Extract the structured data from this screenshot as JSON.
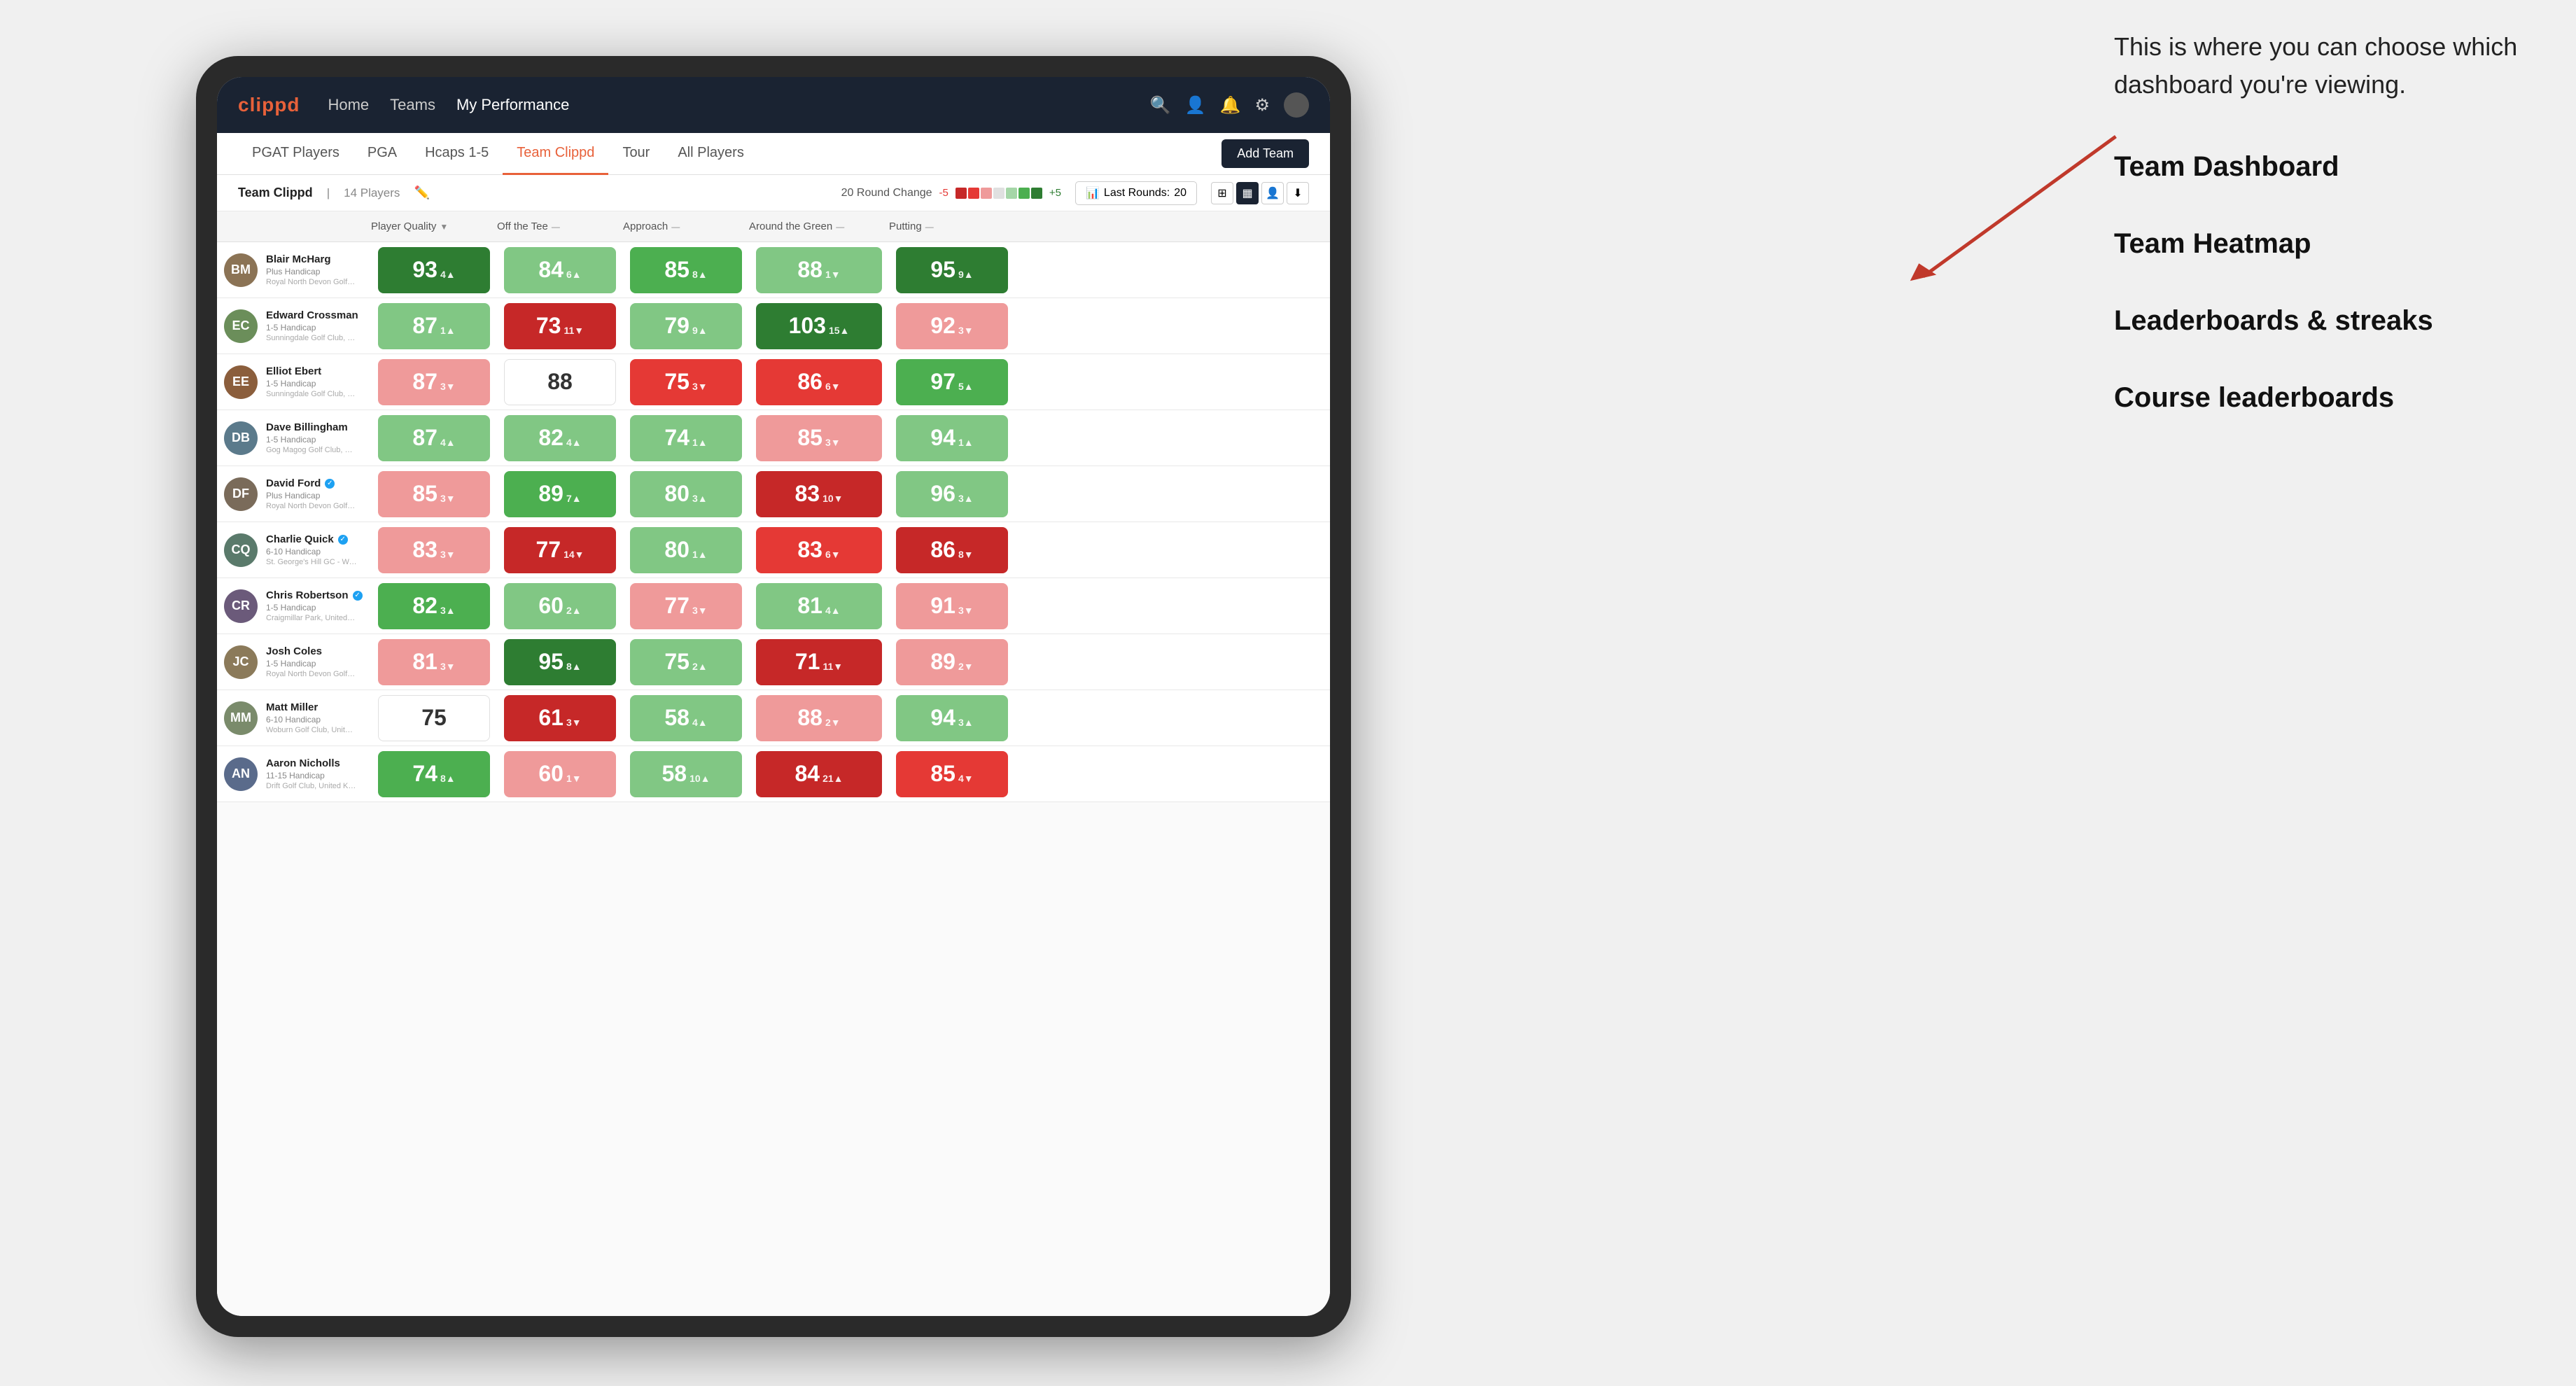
{
  "annotation": {
    "intro_text": "This is where you can choose which dashboard you're viewing.",
    "items": [
      "Team Dashboard",
      "Team Heatmap",
      "Leaderboards & streaks",
      "Course leaderboards"
    ]
  },
  "nav": {
    "logo": "clippd",
    "items": [
      "Home",
      "Teams",
      "My Performance"
    ],
    "active": "My Performance"
  },
  "sub_tabs": {
    "items": [
      "PGAT Players",
      "PGA",
      "Hcaps 1-5",
      "Team Clippd",
      "Tour",
      "All Players"
    ],
    "active": "Team Clippd",
    "add_button": "Add Team"
  },
  "team_bar": {
    "name": "Team Clippd",
    "count": "14 Players",
    "round_change_label": "20 Round Change",
    "range_low": "-5",
    "range_high": "+5",
    "last_rounds_label": "Last Rounds:",
    "last_rounds_value": "20"
  },
  "table": {
    "headers": {
      "player": "Player Quality",
      "tee": "Off the Tee",
      "approach": "Approach",
      "green": "Around the Green",
      "putting": "Putting"
    },
    "players": [
      {
        "name": "Blair McHarg",
        "hcap": "Plus Handicap",
        "club": "Royal North Devon Golf Club, United Kingdom",
        "avatar_color": "#8B7355",
        "initials": "BM",
        "quality": {
          "value": "93",
          "change": "4",
          "dir": "up",
          "color": "green-strong"
        },
        "tee": {
          "value": "84",
          "change": "6",
          "dir": "up",
          "color": "green-light"
        },
        "approach": {
          "value": "85",
          "change": "8",
          "dir": "up",
          "color": "green-mid"
        },
        "green": {
          "value": "88",
          "change": "1",
          "dir": "down",
          "color": "green-light"
        },
        "putting": {
          "value": "95",
          "change": "9",
          "dir": "up",
          "color": "green-strong"
        }
      },
      {
        "name": "Edward Crossman",
        "hcap": "1-5 Handicap",
        "club": "Sunningdale Golf Club, United Kingdom",
        "avatar_color": "#6B8E5A",
        "initials": "EC",
        "quality": {
          "value": "87",
          "change": "1",
          "dir": "up",
          "color": "green-light"
        },
        "tee": {
          "value": "73",
          "change": "11",
          "dir": "down",
          "color": "red-strong"
        },
        "approach": {
          "value": "79",
          "change": "9",
          "dir": "up",
          "color": "green-light"
        },
        "green": {
          "value": "103",
          "change": "15",
          "dir": "up",
          "color": "green-strong"
        },
        "putting": {
          "value": "92",
          "change": "3",
          "dir": "down",
          "color": "red-light"
        }
      },
      {
        "name": "Elliot Ebert",
        "hcap": "1-5 Handicap",
        "club": "Sunningdale Golf Club, United Kingdom",
        "avatar_color": "#8B5E3C",
        "initials": "EE",
        "quality": {
          "value": "87",
          "change": "3",
          "dir": "down",
          "color": "red-light"
        },
        "tee": {
          "value": "88",
          "change": "",
          "dir": "none",
          "color": "white"
        },
        "approach": {
          "value": "75",
          "change": "3",
          "dir": "down",
          "color": "red-mid"
        },
        "green": {
          "value": "86",
          "change": "6",
          "dir": "down",
          "color": "red-mid"
        },
        "putting": {
          "value": "97",
          "change": "5",
          "dir": "up",
          "color": "green-mid"
        }
      },
      {
        "name": "Dave Billingham",
        "hcap": "1-5 Handicap",
        "club": "Gog Magog Golf Club, United Kingdom",
        "avatar_color": "#5B7A8B",
        "initials": "DB",
        "quality": {
          "value": "87",
          "change": "4",
          "dir": "up",
          "color": "green-light"
        },
        "tee": {
          "value": "82",
          "change": "4",
          "dir": "up",
          "color": "green-light"
        },
        "approach": {
          "value": "74",
          "change": "1",
          "dir": "up",
          "color": "green-light"
        },
        "green": {
          "value": "85",
          "change": "3",
          "dir": "down",
          "color": "red-light"
        },
        "putting": {
          "value": "94",
          "change": "1",
          "dir": "up",
          "color": "green-light"
        }
      },
      {
        "name": "David Ford",
        "hcap": "Plus Handicap",
        "club": "Royal North Devon Golf Club, United Kingdom",
        "avatar_color": "#7A6B5A",
        "initials": "DF",
        "verified": true,
        "quality": {
          "value": "85",
          "change": "3",
          "dir": "down",
          "color": "red-light"
        },
        "tee": {
          "value": "89",
          "change": "7",
          "dir": "up",
          "color": "green-mid"
        },
        "approach": {
          "value": "80",
          "change": "3",
          "dir": "up",
          "color": "green-light"
        },
        "green": {
          "value": "83",
          "change": "10",
          "dir": "down",
          "color": "red-strong"
        },
        "putting": {
          "value": "96",
          "change": "3",
          "dir": "up",
          "color": "green-light"
        }
      },
      {
        "name": "Charlie Quick",
        "hcap": "6-10 Handicap",
        "club": "St. George's Hill GC - Weybridge - Surrey, Uni...",
        "avatar_color": "#5A7A6B",
        "initials": "CQ",
        "verified": true,
        "quality": {
          "value": "83",
          "change": "3",
          "dir": "down",
          "color": "red-light"
        },
        "tee": {
          "value": "77",
          "change": "14",
          "dir": "down",
          "color": "red-strong"
        },
        "approach": {
          "value": "80",
          "change": "1",
          "dir": "up",
          "color": "green-light"
        },
        "green": {
          "value": "83",
          "change": "6",
          "dir": "down",
          "color": "red-mid"
        },
        "putting": {
          "value": "86",
          "change": "8",
          "dir": "down",
          "color": "red-strong"
        }
      },
      {
        "name": "Chris Robertson",
        "hcap": "1-5 Handicap",
        "club": "Craigmillar Park, United Kingdom",
        "avatar_color": "#6B5A7A",
        "initials": "CR",
        "verified": true,
        "quality": {
          "value": "82",
          "change": "3",
          "dir": "up",
          "color": "green-mid"
        },
        "tee": {
          "value": "60",
          "change": "2",
          "dir": "up",
          "color": "green-light"
        },
        "approach": {
          "value": "77",
          "change": "3",
          "dir": "down",
          "color": "red-light"
        },
        "green": {
          "value": "81",
          "change": "4",
          "dir": "up",
          "color": "green-light"
        },
        "putting": {
          "value": "91",
          "change": "3",
          "dir": "down",
          "color": "red-light"
        }
      },
      {
        "name": "Josh Coles",
        "hcap": "1-5 Handicap",
        "club": "Royal North Devon Golf Club, United Kingdom",
        "avatar_color": "#8B7A5A",
        "initials": "JC",
        "quality": {
          "value": "81",
          "change": "3",
          "dir": "down",
          "color": "red-light"
        },
        "tee": {
          "value": "95",
          "change": "8",
          "dir": "up",
          "color": "green-strong"
        },
        "approach": {
          "value": "75",
          "change": "2",
          "dir": "up",
          "color": "green-light"
        },
        "green": {
          "value": "71",
          "change": "11",
          "dir": "down",
          "color": "red-strong"
        },
        "putting": {
          "value": "89",
          "change": "2",
          "dir": "down",
          "color": "red-light"
        }
      },
      {
        "name": "Matt Miller",
        "hcap": "6-10 Handicap",
        "club": "Woburn Golf Club, United Kingdom",
        "avatar_color": "#7A8B6B",
        "initials": "MM",
        "quality": {
          "value": "75",
          "change": "",
          "dir": "none",
          "color": "white"
        },
        "tee": {
          "value": "61",
          "change": "3",
          "dir": "down",
          "color": "red-strong"
        },
        "approach": {
          "value": "58",
          "change": "4",
          "dir": "up",
          "color": "green-light"
        },
        "green": {
          "value": "88",
          "change": "2",
          "dir": "down",
          "color": "red-light"
        },
        "putting": {
          "value": "94",
          "change": "3",
          "dir": "up",
          "color": "green-light"
        }
      },
      {
        "name": "Aaron Nicholls",
        "hcap": "11-15 Handicap",
        "club": "Drift Golf Club, United Kingdom",
        "avatar_color": "#5A6B8B",
        "initials": "AN",
        "quality": {
          "value": "74",
          "change": "8",
          "dir": "up",
          "color": "green-mid"
        },
        "tee": {
          "value": "60",
          "change": "1",
          "dir": "down",
          "color": "red-light"
        },
        "approach": {
          "value": "58",
          "change": "10",
          "dir": "up",
          "color": "green-light"
        },
        "green": {
          "value": "84",
          "change": "21",
          "dir": "up",
          "color": "red-strong"
        },
        "putting": {
          "value": "85",
          "change": "4",
          "dir": "down",
          "color": "red-mid"
        }
      }
    ]
  }
}
